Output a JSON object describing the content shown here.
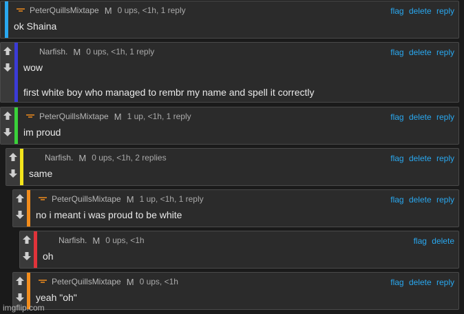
{
  "actions": {
    "flag": "flag",
    "delete": "delete",
    "reply": "reply"
  },
  "comments": [
    {
      "author": "PeterQuillsMixtape",
      "badge": "M",
      "meta": "0 ups, <1h, 1 reply",
      "lines": [
        "ok Shaina"
      ],
      "bar_color": "#29a8f0",
      "has_reply": true,
      "avatar": "meme-avatar"
    },
    {
      "author": "Narfish.",
      "badge": "M",
      "meta": "0 ups, <1h, 1 reply",
      "lines": [
        "wow",
        "first white boy who managed to rembr my name and spell it correctly"
      ],
      "bar_color": "#3b3bd6",
      "has_reply": true,
      "avatar": "none"
    },
    {
      "author": "PeterQuillsMixtape",
      "badge": "M",
      "meta": "1 up, <1h, 1 reply",
      "lines": [
        "im proud"
      ],
      "bar_color": "#3ad13a",
      "has_reply": true,
      "avatar": "meme-avatar"
    },
    {
      "author": "Narfish.",
      "badge": "M",
      "meta": "0 ups, <1h, 2 replies",
      "lines": [
        "same"
      ],
      "bar_color": "#f2e41c",
      "has_reply": true,
      "avatar": "none"
    },
    {
      "author": "PeterQuillsMixtape",
      "badge": "M",
      "meta": "1 up, <1h, 1 reply",
      "lines": [
        "no i meant i was proud to be white"
      ],
      "bar_color": "#f28c1c",
      "has_reply": true,
      "avatar": "meme-avatar"
    },
    {
      "author": "Narfish.",
      "badge": "M",
      "meta": "0 ups, <1h",
      "lines": [
        "oh"
      ],
      "bar_color": "#e0333a",
      "has_reply": false,
      "avatar": "none"
    },
    {
      "author": "PeterQuillsMixtape",
      "badge": "M",
      "meta": "0 ups, <1h",
      "lines": [
        "yeah \"oh\""
      ],
      "bar_color": "#f28c1c",
      "has_reply": true,
      "avatar": "meme-avatar"
    }
  ],
  "watermark": "imgflip.com"
}
